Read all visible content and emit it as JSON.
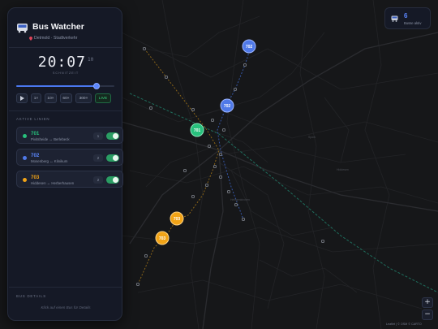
{
  "app": {
    "title": "Bus Watcher",
    "location": "Detmold · Stadtverkehr"
  },
  "clock": {
    "time": "20:07",
    "seconds": "10",
    "label": "SCHNITZEIT"
  },
  "timeline": {
    "progress": 0.82
  },
  "speed_controls": [
    "1×",
    "10×",
    "60×",
    "300×"
  ],
  "live_label": "LIVE",
  "lines_section_title": "AKTIVE LINIEN",
  "lines": [
    {
      "number": "701",
      "route": "Pivitsheide ↔ Berlebeck",
      "count": "1",
      "color": "#27c07c",
      "enabled": true
    },
    {
      "number": "702",
      "route": "Mosenberg ↔ Klinikum",
      "count": "2",
      "color": "#4f79e8",
      "enabled": true
    },
    {
      "number": "703",
      "route": "Hiddesen ↔ Herberhausen",
      "count": "2",
      "color": "#f2a417",
      "enabled": true
    }
  ],
  "details_section_title": "BUS DETAILS",
  "details_empty": "Klick auf einen Bus für Details",
  "bus_counter": {
    "count": "6",
    "label": "Busse aktiv"
  },
  "zoom": {
    "in": "+",
    "out": "−"
  },
  "attribution": "Leaflet | © OSM © CARTO",
  "map": {
    "buses": [
      {
        "line": "702",
        "color": "#4f79e8"
      },
      {
        "line": "702",
        "color": "#4f79e8"
      },
      {
        "line": "701",
        "color": "#27c07c"
      },
      {
        "line": "703",
        "color": "#f2a417"
      },
      {
        "line": "703",
        "color": "#f2a417"
      }
    ],
    "district_labels": [
      "Spork",
      "Heiligenkirchen",
      "Hiddesen"
    ]
  }
}
